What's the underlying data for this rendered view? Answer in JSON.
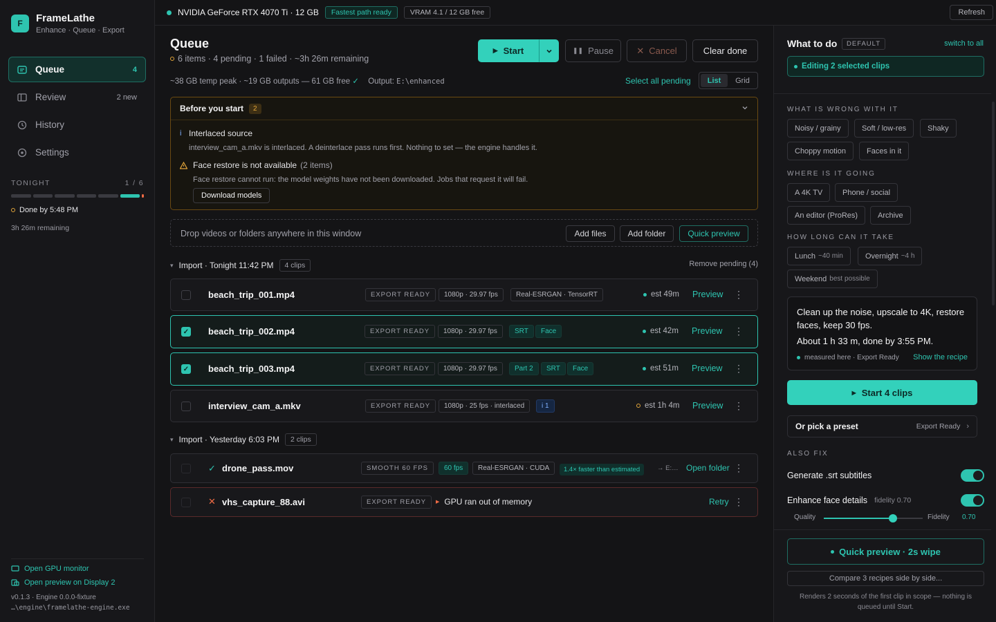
{
  "app": {
    "name": "FrameLathe",
    "subtitle": "Enhance · Queue · Export",
    "logo_letter": "F"
  },
  "colors": {
    "accent": "#2ec4b0",
    "warning": "#e2a53a",
    "error": "#ef6b45",
    "background": "#141416"
  },
  "sidebar": {
    "items": [
      {
        "label": "Queue",
        "count": "4",
        "icon": "queue-icon",
        "active": true
      },
      {
        "label": "Review",
        "count": "2 new",
        "icon": "review-icon"
      },
      {
        "label": "History",
        "count": "",
        "icon": "clock-icon"
      },
      {
        "label": "Settings",
        "count": "",
        "icon": "settings-icon"
      }
    ],
    "tonight": {
      "label": "TONIGHT",
      "progress": "1 / 6",
      "done_by": "Done by 5:48 PM",
      "remaining": "3h 26m remaining"
    },
    "links": {
      "gpu_monitor": "Open GPU monitor",
      "preview_display": "Open preview on Display 2"
    },
    "version": "v0.1.3 · Engine 0.0.0-fixture",
    "engine_path": "…\\engine\\framelathe-engine.exe"
  },
  "topbar": {
    "gpu": "NVIDIA GeForce RTX 4070 Ti · 12 GB",
    "fast_path": "Fastest path ready",
    "vram": "VRAM 4.1 / 12 GB free",
    "refresh": "Refresh"
  },
  "queue": {
    "title": "Queue",
    "summary": "6 items · 4 pending · 1 failed · ~3h 26m remaining",
    "start": "Start",
    "pause": "Pause",
    "cancel": "Cancel",
    "clear_done": "Clear done",
    "meta": "~38 GB temp peak · ~19 GB outputs — 61 GB free",
    "meta_check": "✓",
    "output_label": "Output:",
    "output_path": "E:\\enhanced",
    "select_all": "Select all pending",
    "view_list": "List",
    "view_grid": "Grid"
  },
  "before": {
    "title": "Before you start",
    "count": "2",
    "note1_title": "Interlaced source",
    "note1_desc": "interview_cam_a.mkv is interlaced. A deinterlace pass runs first. Nothing to set — the engine handles it.",
    "note2_title": "Face restore is not available",
    "note2_count": "(2 items)",
    "note2_desc": "Face restore cannot run: the model weights have not been downloaded. Jobs that request it will fail.",
    "download": "Download models"
  },
  "drop": {
    "text": "Drop videos or folders anywhere in this window",
    "add_files": "Add files",
    "add_folder": "Add folder",
    "quick_preview": "Quick preview"
  },
  "groups": [
    {
      "label": "Import · Tonight 11:42 PM",
      "count": "4 clips",
      "action": "Remove pending (4)"
    },
    {
      "label": "Import · Yesterday 6:03 PM",
      "count": "2 clips"
    }
  ],
  "rows": [
    {
      "name": "beach_trip_001.mp4",
      "status": "EXPORT READY",
      "spec": "1080p · 29.97 fps",
      "tags": [
        "Real-ESRGAN · TensorRT"
      ],
      "est": "est 49m",
      "action": "Preview"
    },
    {
      "name": "beach_trip_002.mp4",
      "status": "EXPORT READY",
      "spec": "1080p · 29.97 fps",
      "tags": [
        "SRT",
        "Face"
      ],
      "est": "est 42m",
      "action": "Preview"
    },
    {
      "name": "beach_trip_003.mp4",
      "status": "EXPORT READY",
      "spec": "1080p · 29.97 fps",
      "tags": [
        "Part 2",
        "SRT",
        "Face"
      ],
      "est": "est 51m",
      "action": "Preview"
    },
    {
      "name": "interview_cam_a.mkv",
      "status": "EXPORT READY",
      "spec": "1080p · 25 fps · interlaced",
      "tags": [
        "i 1"
      ],
      "est": "est 1h 4m",
      "action": "Preview"
    },
    {
      "name": "drone_pass.mov",
      "status": "SMOOTH 60 FPS",
      "spec": "60 fps",
      "tags": [
        "Real-ESRGAN · CUDA"
      ],
      "faster": "1.4× faster than estimated",
      "dest": "→ E:…",
      "action": "Open folder",
      "mark": "✓"
    },
    {
      "name": "vhs_capture_88.avi",
      "status": "EXPORT READY",
      "error": "GPU ran out of memory",
      "action": "Retry",
      "mark": "✕"
    }
  ],
  "panel": {
    "title": "What to do",
    "badge": "DEFAULT",
    "switch": "switch to all",
    "editing": "Editing 2 selected clips",
    "wrong": {
      "label": "WHAT IS WRONG WITH IT",
      "chips": [
        "Noisy / grainy",
        "Soft / low-res",
        "Shaky",
        "Choppy motion",
        "Faces in it"
      ]
    },
    "going": {
      "label": "WHERE IS IT GOING",
      "chips": [
        "A 4K TV",
        "Phone / social",
        "An editor (ProRes)",
        "Archive"
      ]
    },
    "long": {
      "label": "HOW LONG CAN IT TAKE",
      "chips": [
        "Lunch",
        "~40 min",
        "Overnight",
        "~4 h",
        "Weekend",
        "best possible"
      ]
    },
    "summary": "Clean up the noise, upscale to 4K, restore faces, keep 30 fps.",
    "time": "About 1 h 33 m, done by 3:55 PM.",
    "measured": "measured here · Export Ready",
    "recipe": "Show the recipe",
    "start_clips": "Start 4 clips",
    "preset_label": "Or pick a preset",
    "preset_value": "Export Ready",
    "also_fix": "ALSO FIX",
    "srt": "Generate .srt subtitles",
    "face": "Enhance face details",
    "fidelity_hint": "fidelity 0.70",
    "slider": {
      "left": "Quality",
      "right": "Fidelity",
      "value": "0.70",
      "level": 0.7
    },
    "quick_preview": "Quick preview · 2s wipe",
    "compare": "Compare 3 recipes side by side...",
    "footer": "Renders 2 seconds of the first clip in scope — nothing is queued until Start."
  }
}
